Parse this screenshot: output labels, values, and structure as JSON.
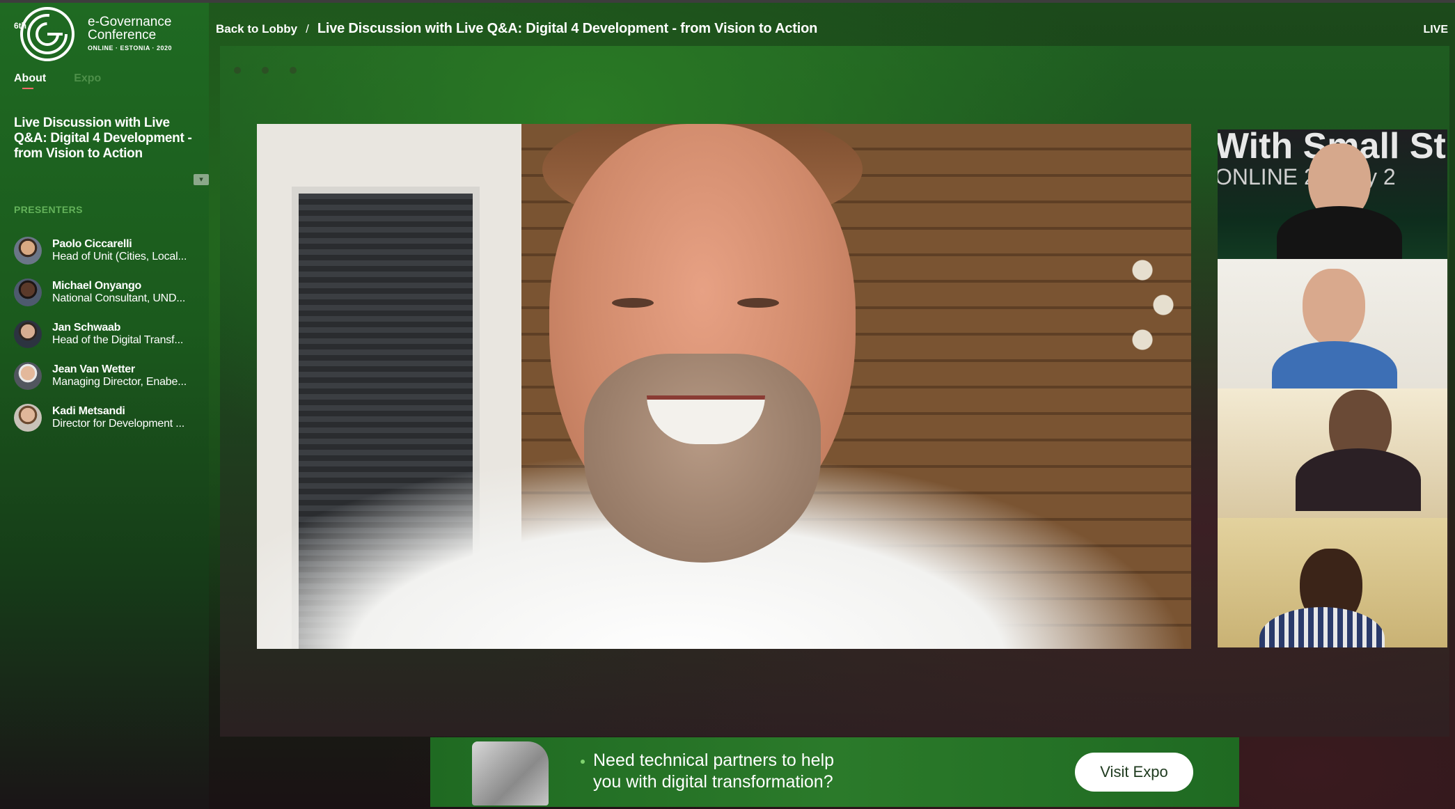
{
  "logo": {
    "superscript": "6th",
    "title_line1": "e-Governance",
    "title_line2": "Conference",
    "subtitle": "ONLINE · ESTONIA · 2020"
  },
  "sidebar": {
    "tabs": [
      {
        "label": "About",
        "active": true
      },
      {
        "label": "Expo",
        "active": false
      }
    ],
    "session_title": "Live Discussion with Live Q&A: Digital 4 Development - from Vision to Action",
    "presenters_heading": "PRESENTERS",
    "presenters": [
      {
        "name": "Paolo Ciccarelli",
        "role": "Head of Unit (Cities, Local..."
      },
      {
        "name": "Michael Onyango",
        "role": "National Consultant, UND..."
      },
      {
        "name": "Jan Schwaab",
        "role": "Head of the Digital Transf..."
      },
      {
        "name": "Jean Van Wetter",
        "role": "Managing Director, Enabe..."
      },
      {
        "name": "Kadi Metsandi",
        "role": "Director for Development ..."
      }
    ]
  },
  "header": {
    "back_label": "Back to Lobby",
    "separator": "/",
    "title": "Live Discussion with Live Q&A: Digital 4 Development - from Vision to Action",
    "live_label": "LIVE"
  },
  "stage": {
    "side_banner_text": "With Small St",
    "side_banner_sub": "ONLINE  21 May 2"
  },
  "ad": {
    "line1": "Need technical partners to help",
    "line2": "you with digital transformation?",
    "button_label": "Visit Expo"
  },
  "colors": {
    "accent_green": "#2b7a2a",
    "sidebar_green": "#1f6a22",
    "presenters_heading": "#63b25a",
    "inactive_tab": "#4d8f49",
    "active_tab_underline": "#ff6b6b"
  }
}
